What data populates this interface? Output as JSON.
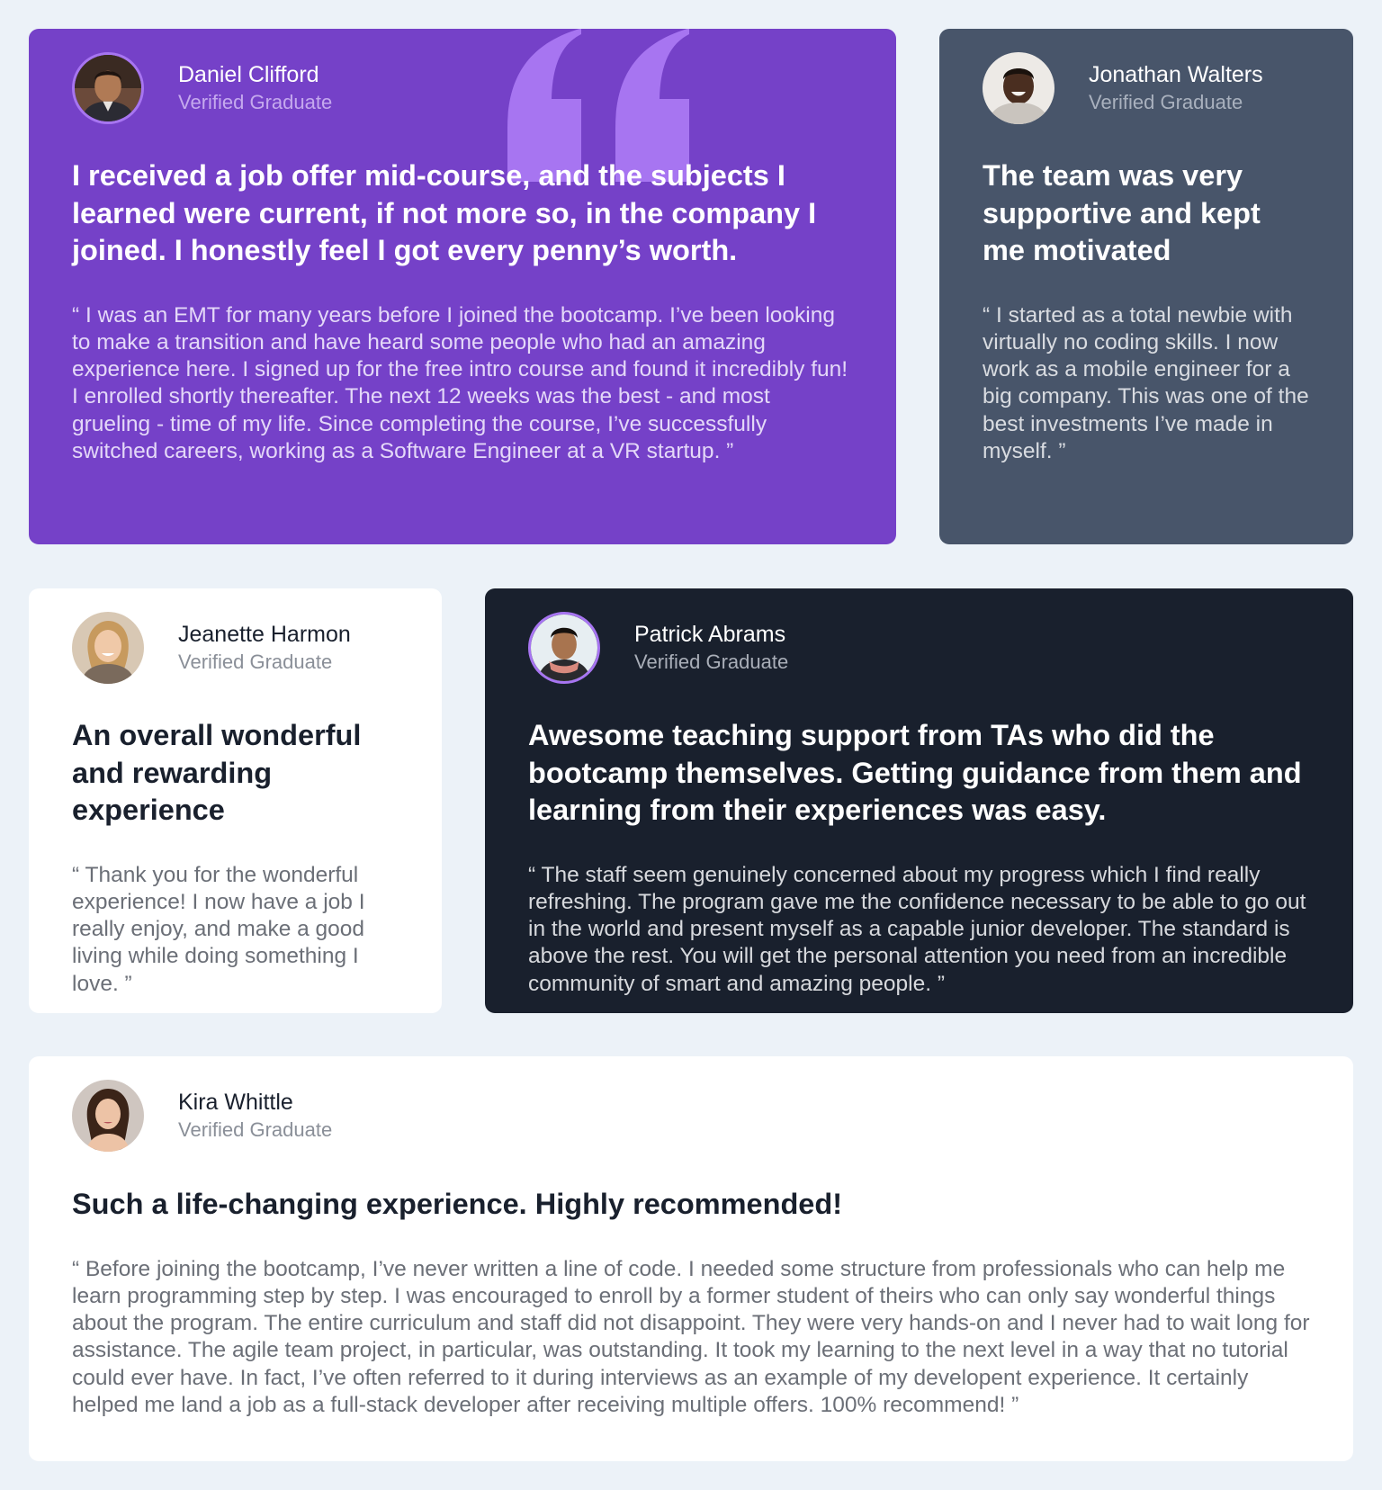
{
  "colors": {
    "page_background": "#ECF2F8",
    "violet": "#7541C8",
    "grayish_blue": "#48556A",
    "very_dark_blue": "#19202D",
    "white": "#FFFFFF",
    "light_violet": "#A775F1"
  },
  "testimonials": [
    {
      "name": "Daniel Clifford",
      "role": "Verified Graduate",
      "headline": "I received a job offer mid-course, and the subjects I learned were current, if not more so, in the company I joined. I honestly feel I got every penny’s worth.",
      "quote": "“ I was an EMT for many years before I joined the bootcamp. I’ve been looking to make a transition and have heard some people who had an amazing experience here. I signed up for the free intro course and found it incredibly fun! I enrolled shortly thereafter. The next 12 weeks was the best - and most grueling - time of my life. Since completing the course, I’ve successfully switched careers, working as a Software Engineer at a VR startup. ”",
      "background": "#7541C8",
      "decoration_icon": "quotation-mark-icon"
    },
    {
      "name": "Jonathan Walters",
      "role": "Verified Graduate",
      "headline": "The team was very supportive and kept me motivated",
      "quote": "“ I started as a total newbie with virtually no coding skills. I now work as a mobile engineer for a big company. This was one of the best investments I’ve made in myself. ”",
      "background": "#48556A"
    },
    {
      "name": "Jeanette Harmon",
      "role": "Verified Graduate",
      "headline": "An overall wonderful and rewarding experience",
      "quote": "“ Thank you for the wonderful experience! I now have a job I really enjoy, and make a good living while doing something I love. ”",
      "background": "#FFFFFF"
    },
    {
      "name": "Patrick Abrams",
      "role": "Verified Graduate",
      "headline": "Awesome teaching support from TAs who did the bootcamp themselves. Getting guidance from them and learning from their experiences was easy.",
      "quote": "“ The staff seem genuinely concerned about my progress which I find really refreshing. The program gave me the confidence necessary to be able to go out in the world and present myself as a capable junior developer. The standard is above the rest. You will get the personal attention you need from an incredible community of smart and amazing people. ”",
      "background": "#19202D"
    },
    {
      "name": "Kira Whittle",
      "role": "Verified Graduate",
      "headline": "Such a life-changing experience. Highly recommended!",
      "quote": "“ Before joining the bootcamp, I’ve never written a line of code. I needed some structure from professionals who can help me learn programming step by step. I was encouraged to enroll by a former student of theirs who can only say wonderful things about the program. The entire curriculum and staff did not disappoint. They were very hands-on and I never had to wait long for assistance. The agile team project, in particular, was outstanding. It took my learning to the next level in a way that no tutorial could ever have. In fact, I’ve often referred to it during interviews as an example of my developent experience. It certainly helped me land a job as a full-stack developer after receiving multiple offers. 100% recommend! ”",
      "background": "#FFFFFF"
    }
  ]
}
